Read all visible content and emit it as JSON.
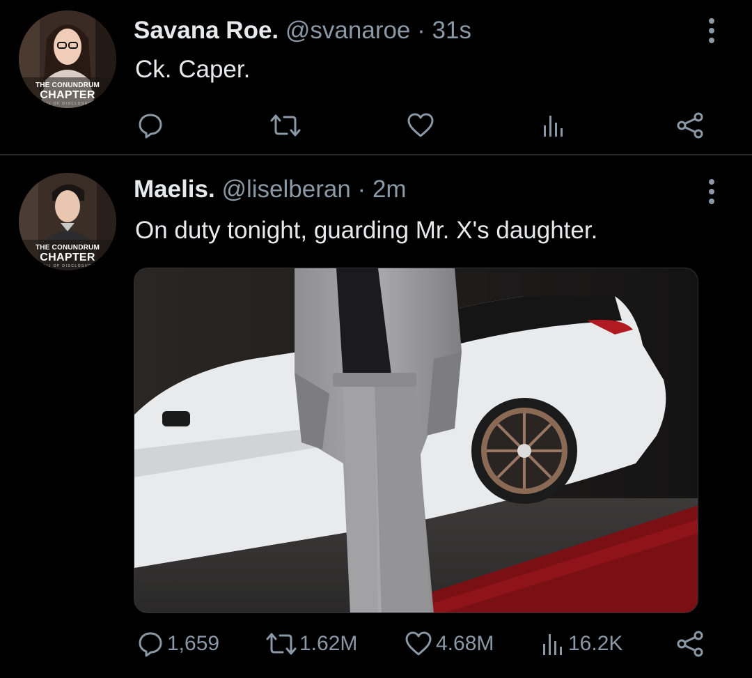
{
  "tweets": [
    {
      "display_name": "Savana Roe.",
      "handle": "@svanaroe",
      "separator": "·",
      "time": "31s",
      "text": "Ck. Caper.",
      "avatar": {
        "brand_line1": "THE CONUNDRUM",
        "brand_line2": "CHAPTER",
        "brand_line3": "VEIL OF DISCLOSURE"
      },
      "actions": {
        "reply_count": "",
        "retweet_count": "",
        "like_count": "",
        "views_count": ""
      },
      "icons": [
        "reply-icon",
        "retweet-icon",
        "like-icon",
        "views-icon",
        "share-icon",
        "more-icon"
      ]
    },
    {
      "display_name": "Maelis.",
      "handle": "@liselberan",
      "separator": "·",
      "time": "2m",
      "text": "On duty tonight, guarding Mr. X's daughter.",
      "avatar": {
        "brand_line1": "THE CONUNDRUM",
        "brand_line2": "CHAPTER",
        "brand_line3": "VEIL OF DISCLOSURE"
      },
      "actions": {
        "reply_count": "1,659",
        "retweet_count": "1.62M",
        "like_count": "4.68M",
        "views_count": "16.2K"
      },
      "icons": [
        "reply-icon",
        "retweet-icon",
        "like-icon",
        "views-icon",
        "share-icon",
        "more-icon"
      ]
    }
  ],
  "colors": {
    "background": "#000000",
    "primary_text": "#e7e9ea",
    "secondary_text": "#8b98a5",
    "divider": "#2a2d30"
  }
}
